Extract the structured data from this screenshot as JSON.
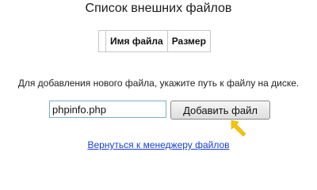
{
  "page": {
    "title": "Список внешних файлов"
  },
  "table": {
    "columns": [
      "",
      "Имя файла",
      "Размер"
    ]
  },
  "upload": {
    "hint": "Для добавления нового файла, укажите путь к файлу на диске.",
    "path_value": "phpinfo.php",
    "add_button_label": "Добавить файл"
  },
  "cursor": {
    "icon": "cursor-arrow-icon",
    "color": "#f5c400"
  },
  "footer": {
    "back_link": "Вернуться к менеджеру файлов",
    "link_color": "#1a3fd8"
  }
}
